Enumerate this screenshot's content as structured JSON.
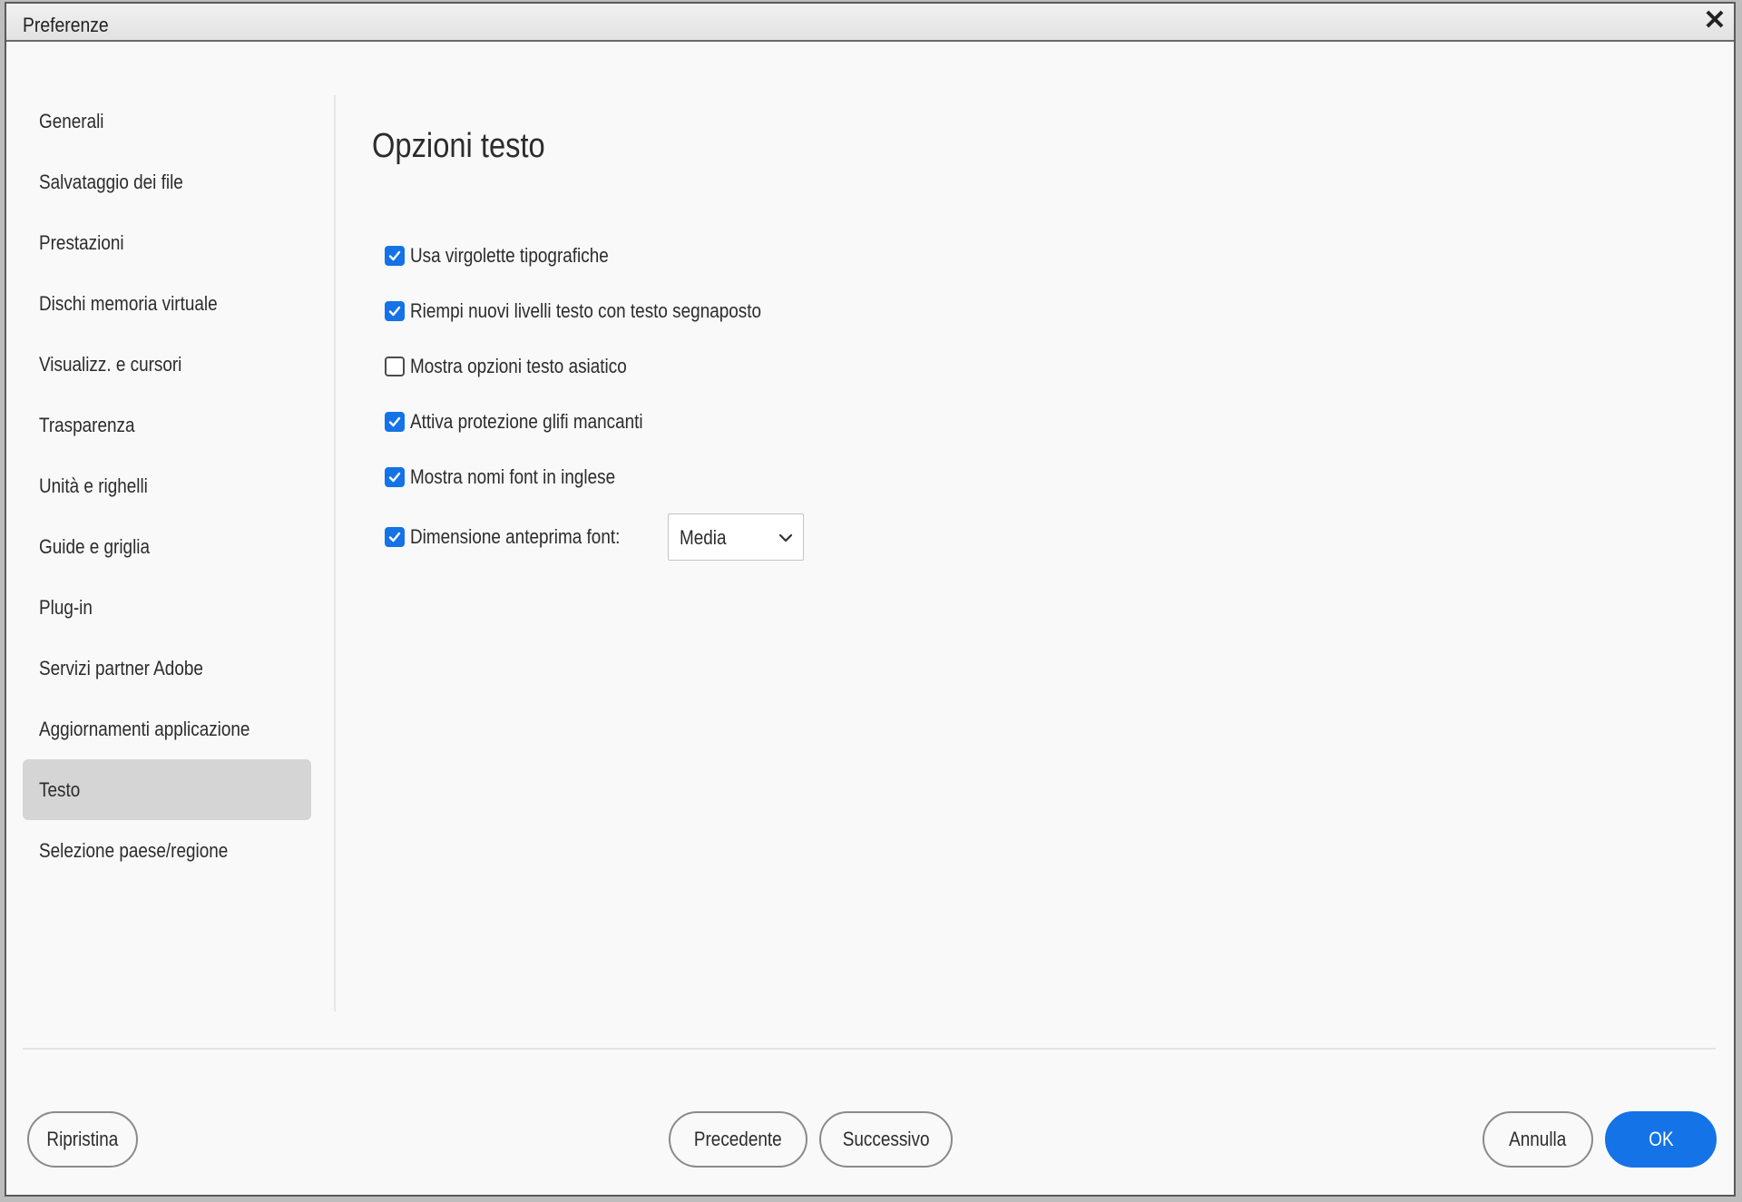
{
  "window": {
    "title": "Preferenze",
    "close_glyph": "✕"
  },
  "sidebar": {
    "items": [
      {
        "label": "Generali",
        "selected": false
      },
      {
        "label": "Salvataggio dei file",
        "selected": false
      },
      {
        "label": "Prestazioni",
        "selected": false
      },
      {
        "label": "Dischi memoria virtuale",
        "selected": false
      },
      {
        "label": "Visualizz. e cursori",
        "selected": false
      },
      {
        "label": "Trasparenza",
        "selected": false
      },
      {
        "label": "Unità e righelli",
        "selected": false
      },
      {
        "label": "Guide e griglia",
        "selected": false
      },
      {
        "label": "Plug-in",
        "selected": false
      },
      {
        "label": "Servizi partner Adobe",
        "selected": false
      },
      {
        "label": "Aggiornamenti applicazione",
        "selected": false
      },
      {
        "label": "Testo",
        "selected": true
      },
      {
        "label": "Selezione paese/regione",
        "selected": false
      }
    ]
  },
  "main": {
    "title": "Opzioni testo",
    "options": [
      {
        "label": "Usa virgolette tipografiche",
        "checked": true
      },
      {
        "label": "Riempi nuovi livelli testo con testo segnaposto",
        "checked": true
      },
      {
        "label": "Mostra opzioni testo asiatico",
        "checked": false
      },
      {
        "label": "Attiva protezione glifi mancanti",
        "checked": true
      },
      {
        "label": "Mostra nomi font in inglese",
        "checked": true
      },
      {
        "label": "Dimensione anteprima font:",
        "checked": true
      }
    ],
    "font_preview_size": {
      "value": "Media",
      "icon": "chevron-down-icon"
    }
  },
  "footer": {
    "reset_label": "Ripristina",
    "previous_label": "Precedente",
    "next_label": "Successivo",
    "cancel_label": "Annulla",
    "ok_label": "OK"
  },
  "colors": {
    "accent": "#1473e6",
    "selected_item_bg": "#d5d5d5",
    "background": "#f9f9f9"
  }
}
